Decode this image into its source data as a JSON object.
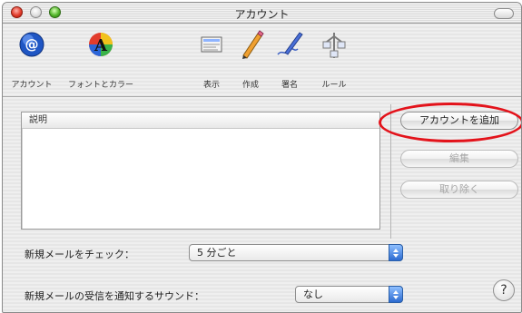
{
  "window": {
    "title": "アカウント"
  },
  "toolbar": {
    "items": [
      {
        "label": "アカウント",
        "icon": "at-sign-icon"
      },
      {
        "label": "フォントとカラー",
        "icon": "font-color-icon"
      },
      {
        "label": "表示",
        "icon": "view-icon"
      },
      {
        "label": "作成",
        "icon": "pencil-icon"
      },
      {
        "label": "署名",
        "icon": "signature-pen-icon"
      },
      {
        "label": "ルール",
        "icon": "rules-icon"
      }
    ]
  },
  "accounts_list": {
    "header": "説明"
  },
  "buttons": {
    "add_account": "アカウントを追加",
    "edit": "編集",
    "remove": "取り除く"
  },
  "check_mail": {
    "label": "新規メールをチェック：",
    "value": "5 分ごと"
  },
  "new_mail_sound": {
    "label": "新規メールの受信を通知するサウンド：",
    "value": "なし"
  },
  "help": {
    "label": "?"
  },
  "colors": {
    "highlight_ring": "#e3131b",
    "popup_accent": "#2c6bd0"
  }
}
